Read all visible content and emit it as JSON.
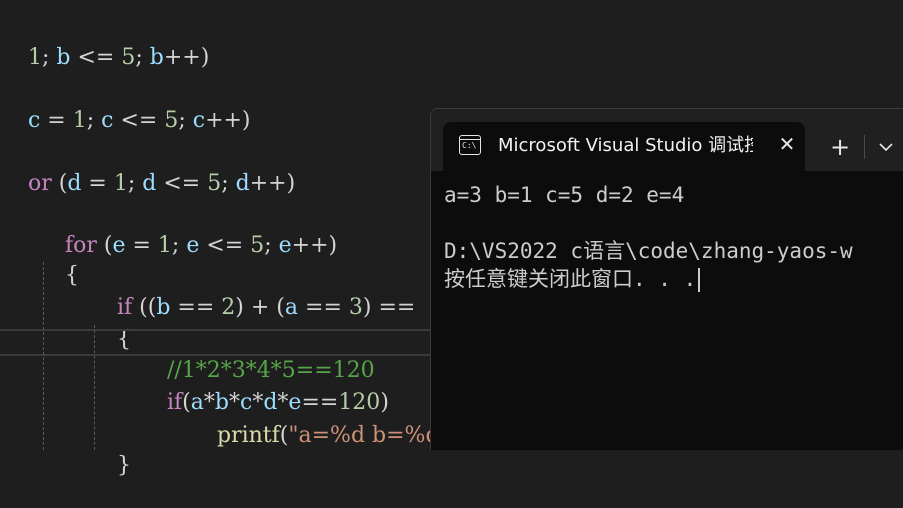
{
  "editor": {
    "lines": [
      [
        "1",
        "; ",
        "b",
        " <= ",
        "5",
        "; ",
        "b",
        "++)"
      ],
      [
        "c",
        " = ",
        "1",
        "; ",
        "c",
        " <= ",
        "5",
        "; ",
        "c",
        "++)"
      ],
      [
        "or",
        " (",
        "d",
        " = ",
        "1",
        "; ",
        "d",
        " <= ",
        "5",
        "; ",
        "d",
        "++)"
      ],
      [
        "for",
        " (",
        "e",
        " = ",
        "1",
        "; ",
        "e",
        " <= ",
        "5",
        "; ",
        "e",
        "++)"
      ],
      [
        "{"
      ],
      [
        "if",
        " ((",
        "b",
        " == ",
        "2",
        ") + (",
        "a",
        " == ",
        "3",
        ") =="
      ],
      [
        "{"
      ],
      [
        "//1*2*3*4*5==120"
      ],
      [
        "if",
        "(",
        "a",
        "*",
        "b",
        "*",
        "c",
        "*",
        "d",
        "*",
        "e",
        "==",
        "120",
        ")"
      ],
      [
        "printf",
        "(",
        "\"a=%d b=%d c"
      ],
      [
        "}"
      ]
    ]
  },
  "terminal": {
    "tab_title": "Microsoft Visual Studio 调试控",
    "tab_icon_text": "C:\\",
    "close_glyph": "✕",
    "new_tab_glyph": "+",
    "output": [
      "a=3 b=1 c=5 d=2 e=4",
      "",
      "D:\\VS2022 c语言\\code\\zhang-yaos-w",
      "按任意键关闭此窗口. . ."
    ]
  },
  "colors": {
    "editor_bg": "#1e1e1e",
    "keyword": "#569cd6",
    "control_keyword": "#c586c0",
    "variable": "#9cdcfe",
    "number": "#b5cea8",
    "function": "#dcdcaa",
    "string": "#ce9178",
    "comment": "#57a64a",
    "terminal_bg": "#0c0c0c",
    "titlebar_bg": "#202020"
  }
}
